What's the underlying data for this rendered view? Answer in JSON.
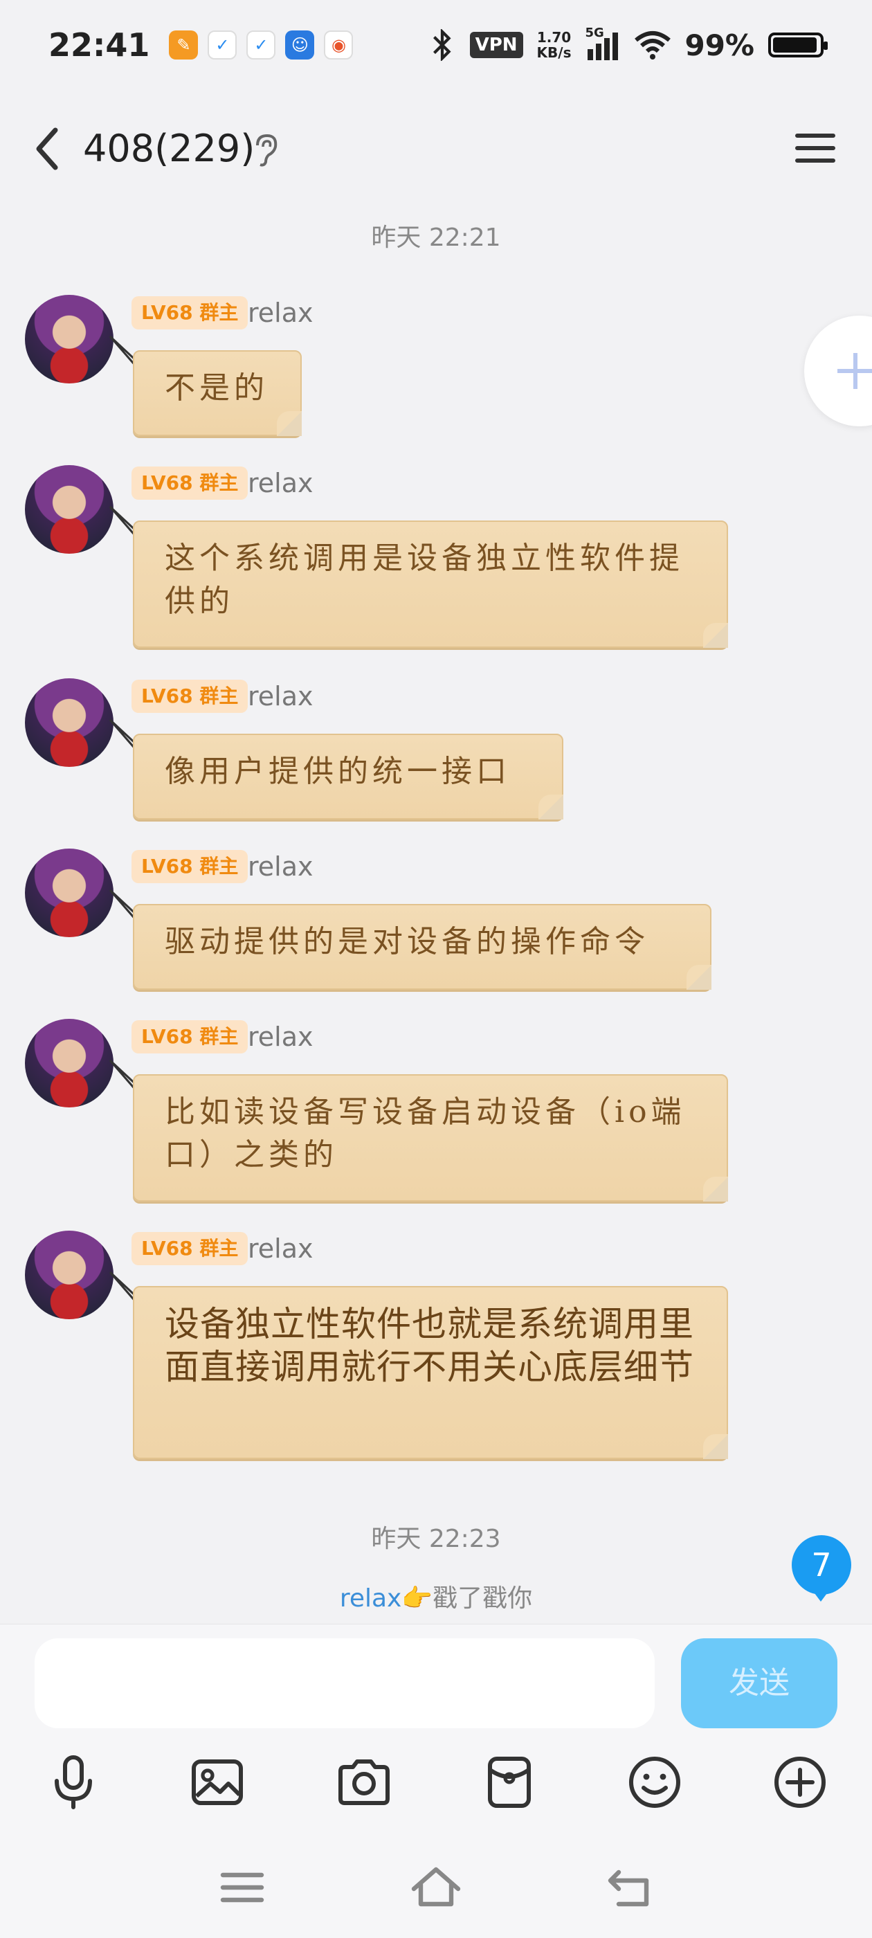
{
  "status_bar": {
    "time": "22:41",
    "vpn": "VPN",
    "speed_value": "1.70",
    "speed_unit": "KB/s",
    "network": "5G",
    "battery": "99%",
    "battery_level": 0.99
  },
  "header": {
    "title": "408(229)"
  },
  "timestamps": {
    "first": "昨天 22:21",
    "second": "昨天 22:23"
  },
  "messages": [
    {
      "badge": "LV68 群主",
      "sender": "relax",
      "text": "不是的"
    },
    {
      "badge": "LV68 群主",
      "sender": "relax",
      "text": "这个系统调用是设备独立性软件提供的"
    },
    {
      "badge": "LV68 群主",
      "sender": "relax",
      "text": "像用户提供的统一接口"
    },
    {
      "badge": "LV68 群主",
      "sender": "relax",
      "text": "驱动提供的是对设备的操作命令"
    },
    {
      "badge": "LV68 群主",
      "sender": "relax",
      "text": "比如读设备写设备启动设备（io端口）之类的"
    },
    {
      "badge": "LV68 群主",
      "sender": "relax",
      "text": "设备独立性软件也就是系统调用里面直接调用就行不用关心底层细节"
    }
  ],
  "poke": {
    "who": "relax",
    "emoji": "👉",
    "text": "戳了戳你"
  },
  "unread_count": "7",
  "input": {
    "value": "",
    "send_label": "发送"
  },
  "icons": {
    "toolbar": [
      "microphone-icon",
      "image-icon",
      "camera-icon",
      "red-packet-icon",
      "emoji-icon",
      "plus-circle-icon"
    ],
    "nav": [
      "menu-icon",
      "home-icon",
      "back-icon"
    ]
  },
  "colors": {
    "bubble": "#efd4a8",
    "bubble_text": "#7a5222",
    "badge_bg": "#fde3c6",
    "badge_text": "#f08a10",
    "send": "#6cc9f9",
    "unread": "#1a9cf2",
    "poke_name": "#3b8ed8"
  }
}
